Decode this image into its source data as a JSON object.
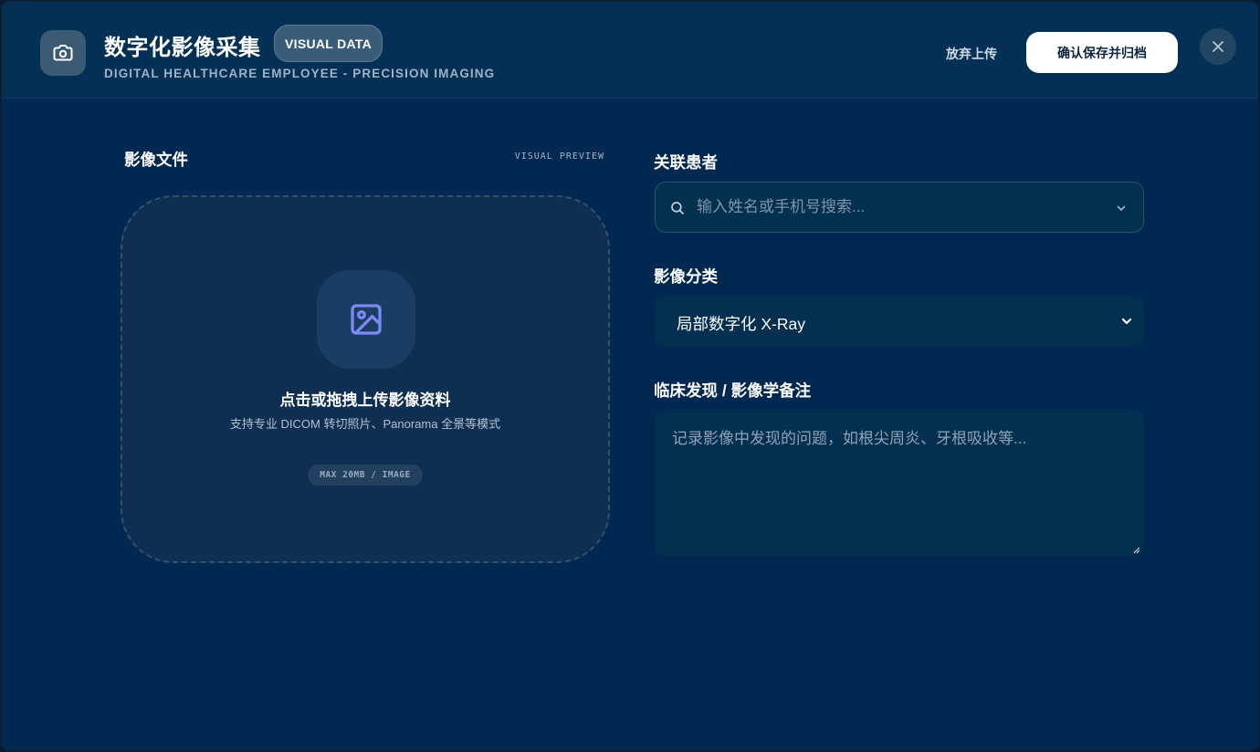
{
  "header": {
    "title": "数字化影像采集",
    "badge": "VISUAL DATA",
    "subtitle": "DIGITAL HEALTHCARE EMPLOYEE - PRECISION IMAGING",
    "discard_label": "放弃上传",
    "confirm_label": "确认保存并归档",
    "icons": {
      "camera": "camera-icon",
      "close": "close-icon"
    }
  },
  "upload": {
    "section_label": "影像文件",
    "preview_label": "VISUAL PREVIEW",
    "title": "点击或拖拽上传影像资料",
    "description": "支持专业 DICOM 转切照片、Panorama 全景等模式",
    "limit": "MAX 20MB / IMAGE",
    "icon": "image-icon"
  },
  "patient": {
    "label": "关联患者",
    "placeholder": "输入姓名或手机号搜索...",
    "value": "",
    "icons": {
      "search": "search-icon",
      "dropdown": "chevron-down-icon"
    }
  },
  "category": {
    "label": "影像分类",
    "selected": "局部数字化 X-Ray",
    "icon": "chevron-down-icon"
  },
  "notes": {
    "label": "临床发现 / 影像学备注",
    "placeholder": "记录影像中发现的问题，如根尖周炎、牙根吸收等...",
    "value": ""
  },
  "colors": {
    "background": "#002850",
    "header": "#033054",
    "dropzone": "#0e2e52",
    "accent_icon": "#7e89f2",
    "confirm_bg": "#ffffff"
  }
}
